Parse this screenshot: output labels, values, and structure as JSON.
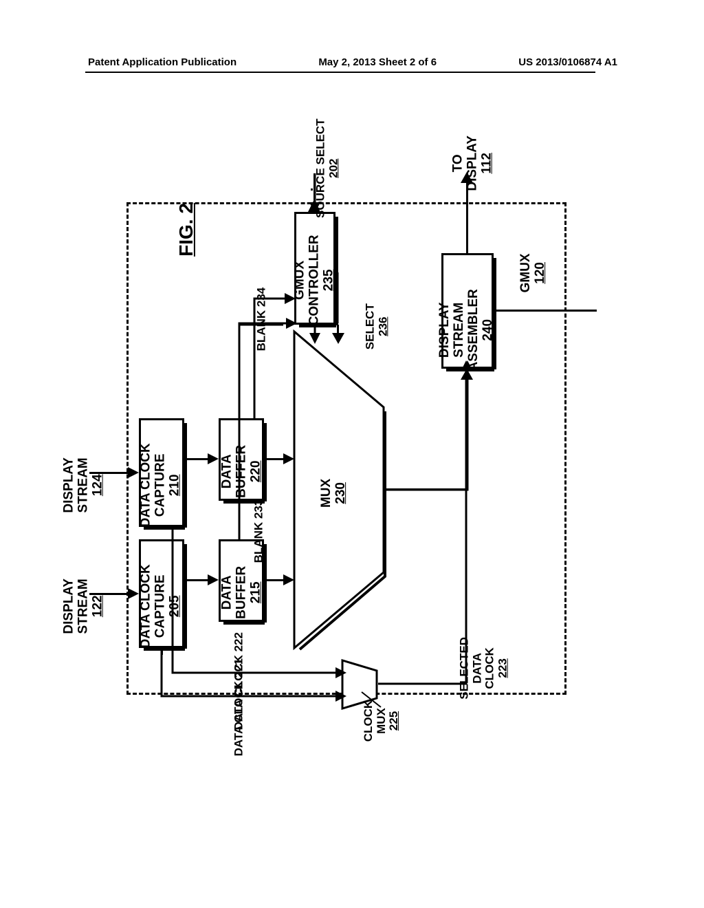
{
  "header": {
    "left": "Patent Application Publication",
    "center": "May 2, 2013  Sheet 2 of 6",
    "right": "US 2013/0106874 A1"
  },
  "figure_label": "FIG. 2",
  "inputs": {
    "display_stream_1": {
      "l1": "DISPLAY",
      "l2": "STREAM",
      "n": "122"
    },
    "display_stream_2": {
      "l1": "DISPLAY",
      "l2": "STREAM",
      "n": "124"
    },
    "source_select": {
      "l1": "SOURCE SELECT",
      "n": "202"
    }
  },
  "blocks": {
    "dcc1": {
      "l1": "DATA CLOCK",
      "l2": "CAPTURE",
      "n": "205"
    },
    "dcc2": {
      "l1": "DATA CLOCK",
      "l2": "CAPTURE",
      "n": "210"
    },
    "db1": {
      "l1": "DATA",
      "l2": "BUFFER",
      "n": "215"
    },
    "db2": {
      "l1": "DATA",
      "l2": "BUFFER",
      "n": "220"
    },
    "mux": {
      "l1": "MUX",
      "n": "230"
    },
    "gmux_ctrl": {
      "l1": "GMUX",
      "l2": "CONTROLLER",
      "n": "235"
    },
    "dsa": {
      "l1": "DISPLAY",
      "l2": "STREAM",
      "l3": "ASSEMBLER",
      "n": "240"
    }
  },
  "signals": {
    "clk1": "DATA CLOCK 221",
    "clk2": "DATA CLOCK 222",
    "clock_mux": {
      "l1": "CLOCK",
      "l2": "MUX",
      "n": "225"
    },
    "sel_clk": {
      "l1": "SELECTED",
      "l2": "DATA",
      "l3": "CLOCK",
      "n": "223"
    },
    "blank233": "BLANK 233",
    "blank234": "BLANK 234",
    "select": {
      "l1": "SELECT",
      "n": "236"
    },
    "gmux_name": {
      "l1": "GMUX",
      "n": "120"
    }
  },
  "output": {
    "l1": "TO",
    "l2": "DISPLAY",
    "n": "112"
  }
}
